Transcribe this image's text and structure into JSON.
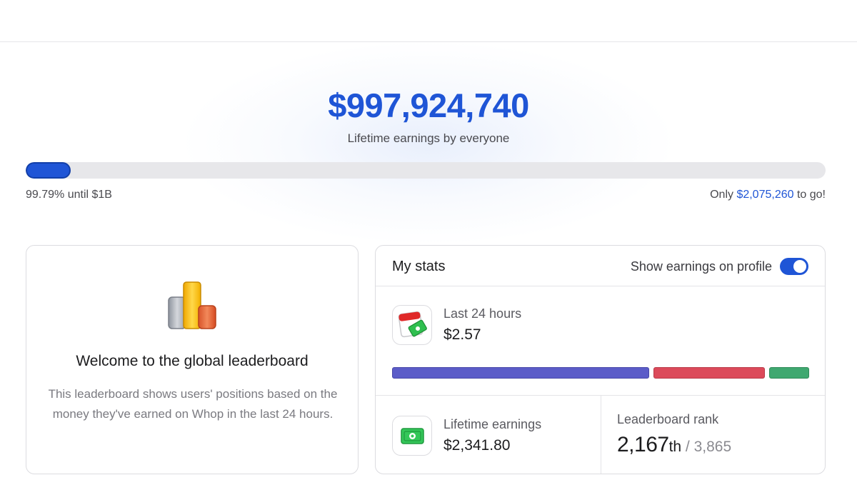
{
  "hero": {
    "amount": "$997,924,740",
    "subtitle": "Lifetime earnings by everyone"
  },
  "progress": {
    "fill_percent": 5.6,
    "left_text": "99.79% until $1B",
    "right_prefix": "Only ",
    "right_amount": "$2,075,260",
    "right_suffix": " to go!"
  },
  "welcome": {
    "icon": "bar-chart-icon",
    "title": "Welcome to the global leaderboard",
    "description": "This leaderboard shows users' positions based on the money they've earned on Whop in the last 24 hours."
  },
  "stats": {
    "title": "My stats",
    "toggle_label": "Show earnings on profile",
    "toggle_on": true,
    "last24": {
      "icon": "calendar-money-icon",
      "label": "Last 24 hours",
      "value": "$2.57"
    },
    "breakdown": [
      {
        "name": "purple",
        "color": "#5b5cc8",
        "share": 0.62
      },
      {
        "name": "red",
        "color": "#dc4a5a",
        "share": 0.27
      },
      {
        "name": "green",
        "color": "#3fa870",
        "share": 0.1
      }
    ],
    "lifetime": {
      "icon": "money-bill-icon",
      "label": "Lifetime earnings",
      "value": "$2,341.80"
    },
    "rank": {
      "label": "Leaderboard rank",
      "number": "2,167",
      "suffix": "th",
      "separator": " / ",
      "total": "3,865"
    }
  },
  "colors": {
    "accent": "#1f55d6"
  }
}
